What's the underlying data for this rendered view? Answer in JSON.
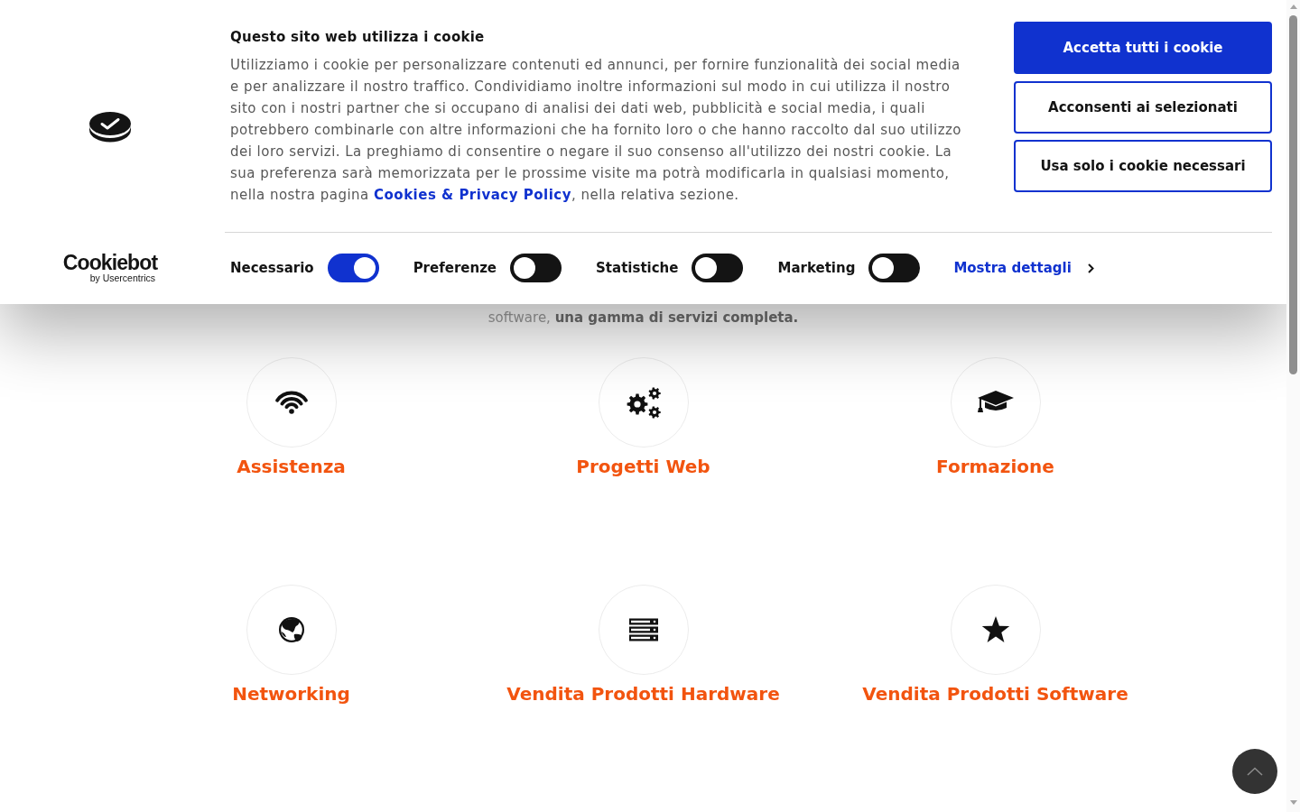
{
  "cookie_banner": {
    "title": "Questo sito web utilizza i cookie",
    "body": "Utilizziamo i cookie per personalizzare contenuti ed annunci, per fornire funzionalità dei social media e per analizzare il nostro traffico. Condividiamo inoltre informazioni sul modo in cui utilizza il nostro sito con i nostri partner che si occupano di analisi dei dati web, pubblicità e social media, i quali potrebbero combinarle con altre informazioni che ha fornito loro o che hanno raccolto dal suo utilizzo dei loro servizi. La preghiamo di consentire o negare il suo consenso all'utilizzo dei nostri cookie. La sua preferenza sarà memorizzata per le prossime visite ma potrà modificarla in qualsiasi momento, nella nostra pagina",
    "policy_link": "Cookies & Privacy Policy",
    "body_end": ", nella relativa sezione.",
    "buttons": [
      {
        "label": "Accetta tutti i cookie",
        "kind": "primary"
      },
      {
        "label": "Acconsenti ai selezionati",
        "kind": "outline"
      },
      {
        "label": "Usa solo i cookie necessari",
        "kind": "outline"
      }
    ],
    "consents": [
      {
        "label": "Necessario",
        "checked": true
      },
      {
        "label": "Preferenze",
        "checked": false
      },
      {
        "label": "Statistiche",
        "checked": false
      },
      {
        "label": "Marketing",
        "checked": false
      }
    ],
    "details_link": "Mostra dettagli",
    "logo": {
      "wordmark": "Cookiebot",
      "tagline": "by Usercentrics"
    }
  },
  "page": {
    "intro": "software, **una gamma di servizi completa.**",
    "services": [
      {
        "title": "Assistenza"
      },
      {
        "title": "Progetti Web"
      },
      {
        "title": "Formazione"
      },
      {
        "title": "Networking"
      },
      {
        "title": "Vendita Prodotti Hardware"
      },
      {
        "title": "Vendita Prodotti Software"
      }
    ]
  }
}
